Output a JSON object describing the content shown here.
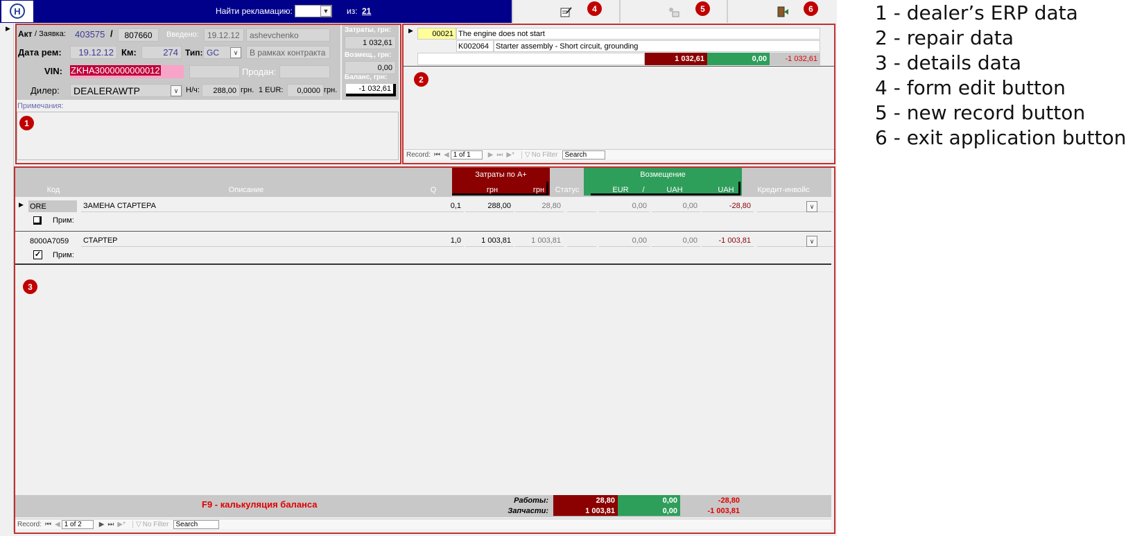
{
  "toolbar": {
    "search_label": "Найти рекламацию:",
    "of_label": "из:",
    "total": "21",
    "edit_icon": "edit-form-icon",
    "new_icon": "new-record-icon",
    "exit_icon": "exit-door-icon"
  },
  "badges": {
    "b1": "1",
    "b2": "2",
    "b3": "3",
    "b4": "4",
    "b5": "5",
    "b6": "6"
  },
  "header": {
    "act_label": "Акт",
    "request_label": "/ Заявка:",
    "act_number": "403575",
    "slash": "/",
    "request_number": "807660",
    "entered_label": "Введено:",
    "entered_date": "19.12.12",
    "entered_user": "ashevchenko",
    "repair_date_label": "Дата рем:",
    "repair_date": "19.12.12",
    "km_label": "Км:",
    "km_value": "274",
    "type_label": "Тип:",
    "type_value": "GC",
    "contract_value": "В рамках контракта",
    "vin_label": "VIN:",
    "vin_value": "ZKHA3000000000012",
    "sold_label": "Продан:",
    "dealer_label": "Дилер:",
    "dealer_value": "DEALERAWTP",
    "nh_label": "Н/ч:",
    "nh_value": "288,00",
    "grn_label1": "грн.",
    "eur_label": "1 EUR:",
    "eur_value": "0,0000",
    "grn_label2": "грн.",
    "notes_label": "Примечания:"
  },
  "totals": {
    "cost_label": "Затраты, грн:",
    "cost_value": "1 032,61",
    "comp_label": "Возмещ., грн:",
    "comp_value": "0,00",
    "balance_label": "Баланс, грн:",
    "balance_value": "-1 032,61"
  },
  "repair": {
    "code": "00021",
    "description": "The engine does not start",
    "sub_code": "K002064",
    "sub_description": "Starter assembly - Short circuit, grounding",
    "sum_cost": "1 032,61",
    "sum_comp": "0,00",
    "sum_balance": "-1 032,61"
  },
  "nav_top": {
    "record_label": "Record:",
    "position": "1 of 1",
    "filter": "No Filter",
    "search": "Search"
  },
  "details_header": {
    "col_code": "Код",
    "col_desc": "Описание",
    "col_q": "Q",
    "costs_group": "Затраты по A+",
    "col_grn1": "грн",
    "col_grn2": "грн",
    "col_status": "Статус",
    "comp_group": "Возмещение",
    "col_eur": "EUR",
    "col_sep": "/",
    "col_uah1": "UAH",
    "col_uah2": "UAH",
    "col_credit": "Кредит-инвойс"
  },
  "rows": [
    {
      "code": "ORE",
      "desc": "ЗАМЕНА СТАРТЕРА",
      "q": "0,1",
      "grn1": "288,00",
      "grn2": "28,80",
      "eur": "0,00",
      "uah1": "0,00",
      "uah2": "-28,80",
      "note_label": "Прим:"
    },
    {
      "code": "8000A7059",
      "desc": "СТАРТЕР",
      "q": "1,0",
      "grn1": "1 003,81",
      "grn2": "1 003,81",
      "eur": "0,00",
      "uah1": "0,00",
      "uah2": "-1 003,81",
      "note_label": "Прим:"
    }
  ],
  "footer": {
    "f9_hint": "F9 - калькуляция баланса",
    "works_label": "Работы:",
    "works_cost": "28,80",
    "works_comp": "0,00",
    "works_balance": "-28,80",
    "parts_label": "Запчасти:",
    "parts_cost": "1 003,81",
    "parts_comp": "0,00",
    "parts_balance": "-1 003,81"
  },
  "nav_bottom": {
    "record_label": "Record:",
    "position": "1 of 2",
    "filter": "No Filter",
    "search": "Search"
  },
  "legend": [
    "1 - dealer’s ERP data",
    "2 - repair data",
    "3 - details data",
    "4 - form edit button",
    "5 - new record button",
    "6 - exit application button"
  ],
  "colors": {
    "navy": "#00008b",
    "maroon": "#8b0000",
    "green": "#2e9e5b",
    "red": "#e00000",
    "frame": "#c03030"
  }
}
